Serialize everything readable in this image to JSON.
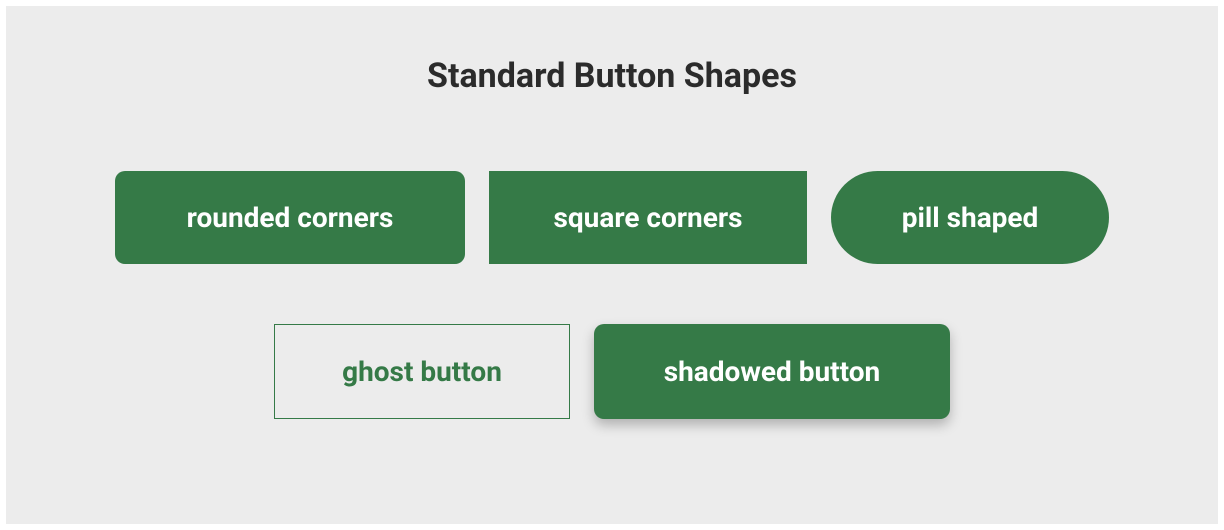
{
  "title": "Standard Button Shapes",
  "buttons": {
    "rounded": "rounded corners",
    "square": "square corners",
    "pill": "pill shaped",
    "ghost": "ghost button",
    "shadowed": "shadowed button"
  },
  "colors": {
    "primary": "#357a47",
    "background": "#ececec",
    "text_dark": "#2b2b2b",
    "text_light": "#ffffff"
  }
}
